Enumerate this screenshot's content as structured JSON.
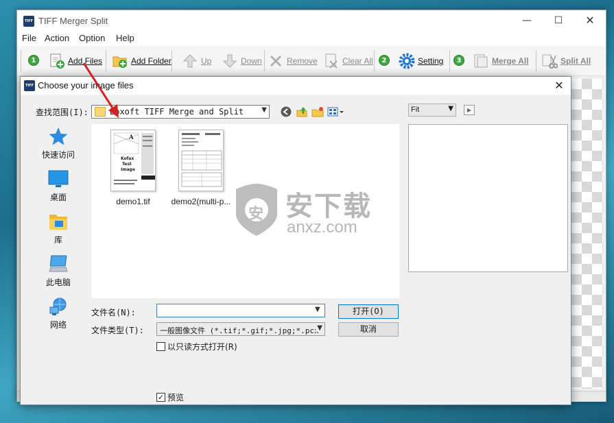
{
  "app": {
    "title": "TIFF Merger Split",
    "icon_text": "TIFF",
    "window_controls": {
      "minimize": "—",
      "maximize": "☐",
      "close": "✕"
    }
  },
  "menu": {
    "file": "File",
    "action": "Action",
    "option": "Option",
    "help": "Help"
  },
  "toolbar": {
    "step1": "1",
    "step2": "2",
    "step3": "3",
    "add_files": "Add Files",
    "add_folder": "Add Folder",
    "up": "Up",
    "down": "Down",
    "remove": "Remove",
    "clear_all": "Clear All",
    "setting": "Setting",
    "merge_all": "Merge All",
    "split_all": "Split All"
  },
  "dialog": {
    "title": "Choose your image files",
    "icon_text": "TIFF",
    "close": "✕",
    "look_in_label": "查找范围(I):",
    "look_in_value": "Boxoft TIFF Merge and Split",
    "places": [
      "快速访问",
      "桌面",
      "库",
      "此电脑",
      "网络"
    ],
    "files": [
      {
        "name": "demo1.tif",
        "thumb_lines": [
          "Kofax",
          "Test",
          "Image"
        ]
      },
      {
        "name": "demo2(multi-p..."
      }
    ],
    "filename_label": "文件名(N):",
    "filename_value": "",
    "filetype_label": "文件类型(T):",
    "filetype_value": "一般图像文件 (*.tif;*.gif;*.jpg;*.pcx",
    "readonly_label": "以只读方式打开(R)",
    "readonly_checked": false,
    "open_button": "打开(O)",
    "cancel_button": "取消",
    "preview_label": "预览",
    "preview_checked": true,
    "zoom_value": "Fit",
    "thumb_a": "A"
  },
  "watermark": {
    "brand": "安下载",
    "domain": "anxz.com",
    "glyph": "安"
  },
  "colors": {
    "accent_green": "#3ea83e",
    "annotation_red": "#d42020",
    "setting_blue": "#1e78d4"
  }
}
